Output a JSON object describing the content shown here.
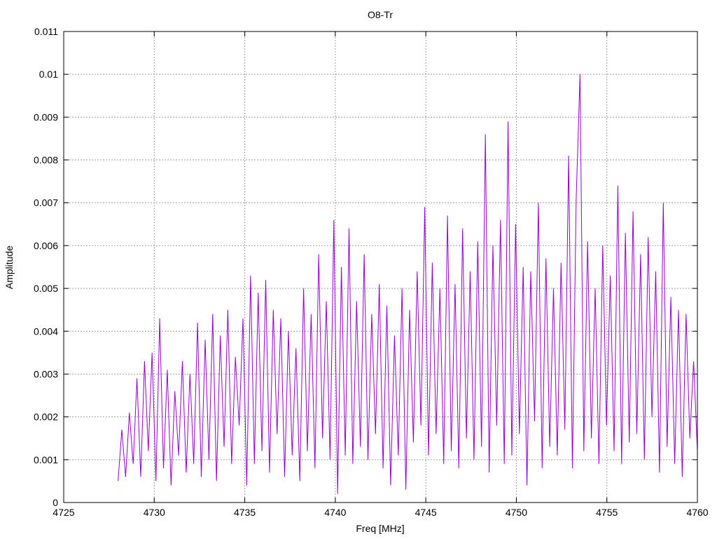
{
  "chart_data": {
    "type": "line",
    "title": "O8-Tr",
    "xlabel": "Freq [MHz]",
    "ylabel": "Amplitude",
    "xlim": [
      4725,
      4760
    ],
    "ylim": [
      0,
      0.011
    ],
    "grid": true,
    "legend": "none",
    "xticks": [
      "4725",
      "4730",
      "4735",
      "4740",
      "4745",
      "4750",
      "4755",
      "4760"
    ],
    "xtick_values": [
      4725,
      4730,
      4735,
      4740,
      4745,
      4750,
      4755,
      4760
    ],
    "yticks": [
      "0",
      "0.001",
      "0.002",
      "0.003",
      "0.004",
      "0.005",
      "0.006",
      "0.007",
      "0.008",
      "0.009",
      "0.01",
      "0.011"
    ],
    "ytick_values": [
      0,
      0.001,
      0.002,
      0.003,
      0.004,
      0.005,
      0.006,
      0.007,
      0.008,
      0.009,
      0.01,
      0.011
    ],
    "series": [
      {
        "name": "O8-Tr",
        "color": "#9400d3",
        "x_range": [
          4728,
          4760
        ],
        "values": [
          0.0005,
          0.0017,
          0.0006,
          0.0021,
          0.0009,
          0.0029,
          0.0006,
          0.0033,
          0.0012,
          0.0035,
          0.0005,
          0.0043,
          0.0008,
          0.0031,
          0.0004,
          0.0026,
          0.0011,
          0.0033,
          0.0007,
          0.003,
          0.0009,
          0.0042,
          0.0006,
          0.0038,
          0.001,
          0.0044,
          0.0005,
          0.0039,
          0.0013,
          0.0045,
          0.0009,
          0.0034,
          0.0018,
          0.0043,
          0.0004,
          0.0053,
          0.0009,
          0.0049,
          0.0012,
          0.0052,
          0.0007,
          0.0045,
          0.0016,
          0.0043,
          0.0006,
          0.004,
          0.0011,
          0.0036,
          0.0005,
          0.005,
          0.0012,
          0.0044,
          0.0008,
          0.0058,
          0.0015,
          0.0047,
          0.001,
          0.0066,
          0.0002,
          0.0055,
          0.0011,
          0.0064,
          0.0009,
          0.0047,
          0.0013,
          0.0058,
          0.001,
          0.0044,
          0.0016,
          0.0051,
          0.0008,
          0.0046,
          0.0004,
          0.0039,
          0.0011,
          0.005,
          0.0003,
          0.0045,
          0.0014,
          0.0054,
          0.0018,
          0.0069,
          0.0011,
          0.0056,
          0.0016,
          0.005,
          0.0009,
          0.0067,
          0.0012,
          0.0051,
          0.0008,
          0.0064,
          0.0015,
          0.0054,
          0.001,
          0.0061,
          0.0013,
          0.0086,
          0.0007,
          0.006,
          0.0018,
          0.0066,
          0.0009,
          0.0089,
          0.0011,
          0.0065,
          0.0016,
          0.0055,
          0.0004,
          0.0054,
          0.0019,
          0.007,
          0.0008,
          0.0057,
          0.0013,
          0.005,
          0.0011,
          0.0056,
          0.0017,
          0.0081,
          0.0008,
          0.0071,
          0.01,
          0.0012,
          0.0061,
          0.0015,
          0.005,
          0.0009,
          0.006,
          0.0018,
          0.0053,
          0.0012,
          0.0074,
          0.0009,
          0.0063,
          0.0014,
          0.0068,
          0.0016,
          0.0058,
          0.001,
          0.0062,
          0.002,
          0.0054,
          0.0007,
          0.007,
          0.0013,
          0.0048,
          0.0009,
          0.0045,
          0.0006,
          0.0044,
          0.0015,
          0.0033,
          0.0012
        ]
      }
    ]
  }
}
